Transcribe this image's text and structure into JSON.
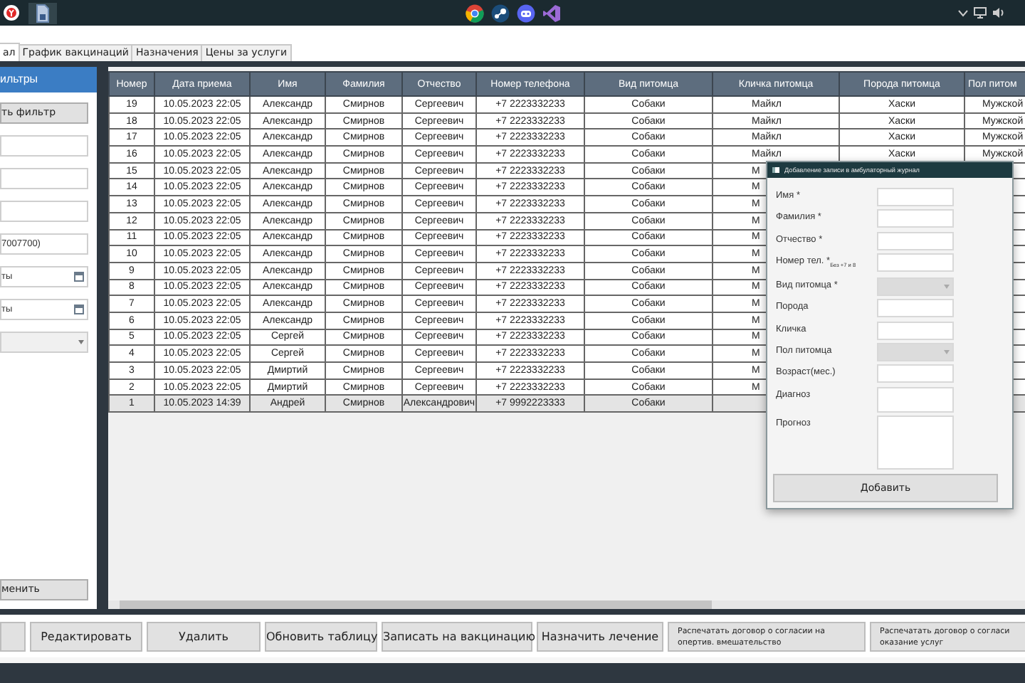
{
  "tabs": [
    {
      "label": "ал",
      "selected": true
    },
    {
      "label": "График вакцинаций",
      "selected": false
    },
    {
      "label": "Назначения",
      "selected": false
    },
    {
      "label": "Цены за услуги",
      "selected": false
    }
  ],
  "filter_panel": {
    "title": "ильтры",
    "apply_button": "ть фильтр",
    "fields": [
      {
        "kind": "text"
      },
      {
        "kind": "text"
      },
      {
        "kind": "text"
      },
      {
        "kind": "text",
        "value": "7007700)"
      },
      {
        "kind": "date",
        "value": "ты"
      },
      {
        "kind": "date",
        "value": "ты"
      },
      {
        "kind": "select"
      }
    ],
    "reset_button": "менить"
  },
  "table": {
    "columns": [
      "Номер",
      "Дата приема",
      "Имя",
      "Фамилия",
      "Отчество",
      "Номер телефона",
      "Вид питомца",
      "Кличка питомца",
      "Порода питомца",
      "Пол питом"
    ],
    "rows": [
      {
        "selected": false,
        "cells": [
          "19",
          "10.05.2023 22:05",
          "Александр",
          "Смирнов",
          "Сергеевич",
          "+7 2223332233",
          "Собаки",
          "Майкл",
          "Хаски",
          "Мужской"
        ]
      },
      {
        "selected": false,
        "cells": [
          "18",
          "10.05.2023 22:05",
          "Александр",
          "Смирнов",
          "Сергеевич",
          "+7 2223332233",
          "Собаки",
          "Майкл",
          "Хаски",
          "Мужской"
        ]
      },
      {
        "selected": false,
        "cells": [
          "17",
          "10.05.2023 22:05",
          "Александр",
          "Смирнов",
          "Сергеевич",
          "+7 2223332233",
          "Собаки",
          "Майкл",
          "Хаски",
          "Мужской"
        ]
      },
      {
        "selected": false,
        "cells": [
          "16",
          "10.05.2023 22:05",
          "Александр",
          "Смирнов",
          "Сергеевич",
          "+7 2223332233",
          "Собаки",
          "Майкл",
          "Хаски",
          "Мужской"
        ]
      },
      {
        "selected": false,
        "cells": [
          "15",
          "10.05.2023 22:05",
          "Александр",
          "Смирнов",
          "Сергеевич",
          "+7 2223332233",
          "Собаки",
          "М"
        ]
      },
      {
        "selected": false,
        "cells": [
          "14",
          "10.05.2023 22:05",
          "Александр",
          "Смирнов",
          "Сергеевич",
          "+7 2223332233",
          "Собаки",
          "М"
        ]
      },
      {
        "selected": false,
        "cells": [
          "13",
          "10.05.2023 22:05",
          "Александр",
          "Смирнов",
          "Сергеевич",
          "+7 2223332233",
          "Собаки",
          "М"
        ]
      },
      {
        "selected": false,
        "cells": [
          "12",
          "10.05.2023 22:05",
          "Александр",
          "Смирнов",
          "Сергеевич",
          "+7 2223332233",
          "Собаки",
          "М"
        ]
      },
      {
        "selected": false,
        "cells": [
          "11",
          "10.05.2023 22:05",
          "Александр",
          "Смирнов",
          "Сергеевич",
          "+7 2223332233",
          "Собаки",
          "М"
        ]
      },
      {
        "selected": false,
        "cells": [
          "10",
          "10.05.2023 22:05",
          "Александр",
          "Смирнов",
          "Сергеевич",
          "+7 2223332233",
          "Собаки",
          "М"
        ]
      },
      {
        "selected": false,
        "cells": [
          "9",
          "10.05.2023 22:05",
          "Александр",
          "Смирнов",
          "Сергеевич",
          "+7 2223332233",
          "Собаки",
          "М"
        ]
      },
      {
        "selected": false,
        "cells": [
          "8",
          "10.05.2023 22:05",
          "Александр",
          "Смирнов",
          "Сергеевич",
          "+7 2223332233",
          "Собаки",
          "М"
        ]
      },
      {
        "selected": false,
        "cells": [
          "7",
          "10.05.2023 22:05",
          "Александр",
          "Смирнов",
          "Сергеевич",
          "+7 2223332233",
          "Собаки",
          "М"
        ]
      },
      {
        "selected": false,
        "cells": [
          "6",
          "10.05.2023 22:05",
          "Александр",
          "Смирнов",
          "Сергеевич",
          "+7 2223332233",
          "Собаки",
          "М"
        ]
      },
      {
        "selected": false,
        "cells": [
          "5",
          "10.05.2023 22:05",
          "Сергей",
          "Смирнов",
          "Сергеевич",
          "+7 2223332233",
          "Собаки",
          "М"
        ]
      },
      {
        "selected": false,
        "cells": [
          "4",
          "10.05.2023 22:05",
          "Сергей",
          "Смирнов",
          "Сергеевич",
          "+7 2223332233",
          "Собаки",
          "М"
        ]
      },
      {
        "selected": false,
        "cells": [
          "3",
          "10.05.2023 22:05",
          "Дмиртий",
          "Смирнов",
          "Сергеевич",
          "+7 2223332233",
          "Собаки",
          "М"
        ]
      },
      {
        "selected": false,
        "cells": [
          "2",
          "10.05.2023 22:05",
          "Дмиртий",
          "Смирнов",
          "Сергеевич",
          "+7 2223332233",
          "Собаки",
          "М"
        ]
      },
      {
        "selected": true,
        "cells": [
          "1",
          "10.05.2023 14:39",
          "Андрей",
          "Смирнов",
          "Александрович",
          "+7 9992223333",
          "Собаки"
        ]
      }
    ]
  },
  "dialog": {
    "title": "Добавление записи в амбулаторный журнал",
    "fields": [
      {
        "label": "Имя *",
        "kind": "text"
      },
      {
        "label": "Фамилия *",
        "kind": "text"
      },
      {
        "label": "Отчество *",
        "kind": "text"
      },
      {
        "label": "Номер тел. *$_{Без +7 и 8}$",
        "kind": "text"
      },
      {
        "label": "Вид питомца *",
        "kind": "select",
        "disabled": true
      },
      {
        "label": "Порода",
        "kind": "text"
      },
      {
        "label": "Кличка",
        "kind": "text"
      },
      {
        "label": "Пол питомца",
        "kind": "select",
        "disabled": true
      },
      {
        "label": "Возраст(мес.)",
        "kind": "text"
      },
      {
        "label": "Диагноз",
        "kind": "area"
      },
      {
        "label": "Прогноз",
        "kind": "large_area"
      }
    ],
    "submit_button": "Добавить"
  },
  "toolbar": {
    "buttons": [
      {
        "kind": "blank"
      },
      {
        "kind": "large",
        "lines": [
          "Редактировать"
        ]
      },
      {
        "kind": "large",
        "lines": [
          "Удалить"
        ]
      },
      {
        "kind": "large",
        "lines": [
          "Обновить таблицу"
        ]
      },
      {
        "kind": "large",
        "lines": [
          "Записать на вакцинацию"
        ]
      },
      {
        "kind": "large",
        "lines": [
          "Назначить лечение"
        ]
      },
      {
        "kind": "small",
        "lines": [
          "Распечатать договор о согласии на",
          "опертив. вмешательство"
        ]
      },
      {
        "kind": "small",
        "lines": [
          "Распечатать договор о согласи",
          "оказание услуг"
        ]
      }
    ]
  }
}
